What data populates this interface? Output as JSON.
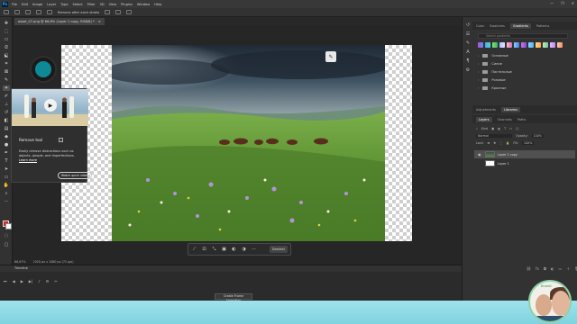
{
  "app": {
    "logo": "Ps",
    "menu": [
      "File",
      "Edit",
      "Image",
      "Layer",
      "Type",
      "Select",
      "Filter",
      "3D",
      "View",
      "Plugins",
      "Window",
      "Help"
    ],
    "window_controls": [
      "—",
      "❐",
      "✕"
    ]
  },
  "options_bar": {
    "label": "Remove after each stroke"
  },
  "document": {
    "tab_title": "asset_07.png @ 66,6% (Layer 1 copy, RGB/8) *",
    "tab_close": "×",
    "zoom": "66,67%",
    "size": "1920 px x 1080 px (72 ppi)"
  },
  "tooltip": {
    "title": "Remove tool",
    "info": "i",
    "description": "Easily remove distractions such as objects, people, and imperfections.",
    "learn_more": "Learn more",
    "watch_button": "Watch quick video"
  },
  "contextual_bar": {
    "icons": [
      "select-subject",
      "transform",
      "crop",
      "mask",
      "circle",
      "fill",
      "more"
    ],
    "button": "Deselect"
  },
  "timeline": {
    "title": "Timeline",
    "create_button": "Create Frame Animation"
  },
  "right_panel": {
    "top_tabs": [
      "Color",
      "Swatches",
      "Gradients",
      "Patterns"
    ],
    "active_top_tab": "Gradients",
    "search_placeholder": "Search gradients",
    "gradient_groups": [
      "Основные",
      "Синие",
      "Пастельные",
      "Розовые",
      "Красные"
    ],
    "adjust_tabs": [
      "Adjustments",
      "Libraries"
    ],
    "layers_tabs": [
      "Layers",
      "Channels",
      "Paths"
    ],
    "kind_label": "Kind",
    "blend_mode": "Normal",
    "opacity_label": "Opacity:",
    "opacity_value": "100%",
    "lock_label": "Lock:",
    "fill_label": "Fill:",
    "fill_value": "100%",
    "layers": [
      {
        "name": "Layer 1 copy",
        "selected": true
      },
      {
        "name": "Layer 1",
        "selected": false
      }
    ]
  },
  "avatar": {
    "caption": "Krumb"
  },
  "colors": {
    "accent_teal": "#0e8a96",
    "foreground": "#e02020",
    "background": "#ffffff",
    "bottom_band": "#8fd9e4"
  }
}
